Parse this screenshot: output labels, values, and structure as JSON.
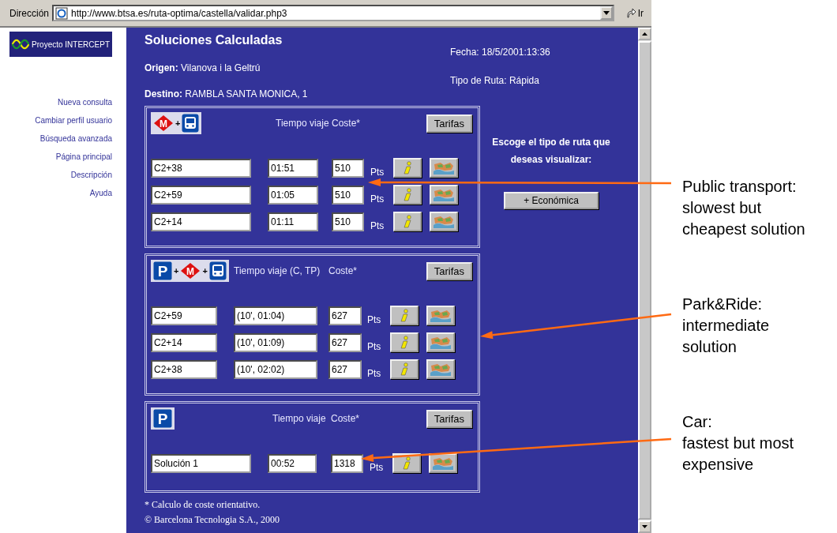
{
  "address_bar": {
    "label": "Dirección",
    "url": "http://www.btsa.es/ruta-optima/castella/validar.php3",
    "go": "Ir"
  },
  "logo": {
    "text": "Proyecto INTERCEPT"
  },
  "sidebar": {
    "items": [
      {
        "label": "Nueva consulta"
      },
      {
        "label": "Cambiar perfil usuario"
      },
      {
        "label": "Búsqueda avanzada"
      },
      {
        "label": "Página principal"
      },
      {
        "label": "Descripción"
      },
      {
        "label": "Ayuda"
      }
    ]
  },
  "header": {
    "title": "Soluciones Calculadas",
    "origin_label": "Origen:",
    "origin": "Vilanova i la Geltrú",
    "destination_label": "Destino:",
    "destination": "RAMBLA SANTA MONICA, 1",
    "date": "Fecha: 18/5/2001:13:36",
    "route_type": "Tipo de Ruta: Rápida"
  },
  "sections": [
    {
      "kind": "public_transport",
      "joiner": "+",
      "modes": [
        {
          "kind": "metro",
          "label": "M"
        },
        {
          "kind": "bus"
        }
      ],
      "time_header": "Tiempo viaje",
      "cost_header": "Coste*",
      "tariff_button": "Tarifas",
      "rows": [
        {
          "route": "C2+38",
          "time": "01:51",
          "cost": "510",
          "unit": "Pts"
        },
        {
          "route": "C2+59",
          "time": "01:05",
          "cost": "510",
          "unit": "Pts"
        },
        {
          "route": "C2+14",
          "time": "01:11",
          "cost": "510",
          "unit": "Pts"
        }
      ]
    },
    {
      "kind": "park_and_ride",
      "joiner": "+",
      "modes": [
        {
          "kind": "parking",
          "label": "P"
        },
        {
          "kind": "metro",
          "label": "M"
        },
        {
          "kind": "bus"
        }
      ],
      "time_header": "Tiempo viaje (C, TP)",
      "cost_header": "Coste*",
      "tariff_button": "Tarifas",
      "rows": [
        {
          "route": "C2+59",
          "time": "(10', 01:04)",
          "cost": "627",
          "unit": "Pts"
        },
        {
          "route": "C2+14",
          "time": "(10', 01:09)",
          "cost": "627",
          "unit": "Pts"
        },
        {
          "route": "C2+38",
          "time": "(10', 02:02)",
          "cost": "627",
          "unit": "Pts"
        }
      ]
    },
    {
      "kind": "car",
      "modes": [
        {
          "kind": "parking",
          "label": "P"
        }
      ],
      "time_header": "Tiempo viaje",
      "cost_header": "Coste*",
      "tariff_button": "Tarifas",
      "rows": [
        {
          "route": "Solución 1",
          "time": "00:52",
          "cost": "1318",
          "unit": "Pts"
        }
      ]
    }
  ],
  "route_choice": {
    "prompt": "Escoge el tipo de ruta que deseas visualizar:",
    "button": "+ Económica"
  },
  "footer": {
    "note": "* Calculo de coste orientativo.",
    "copyright": "© Barcelona Tecnologia S.A., 2000"
  },
  "annotations": [
    {
      "lines": [
        "Public transport:",
        "slowest but",
        "cheapest solution"
      ]
    },
    {
      "lines": [
        "Park&Ride:",
        "intermediate",
        "solution"
      ]
    },
    {
      "lines": [
        "Car:",
        "fastest but most",
        "expensive"
      ]
    }
  ]
}
